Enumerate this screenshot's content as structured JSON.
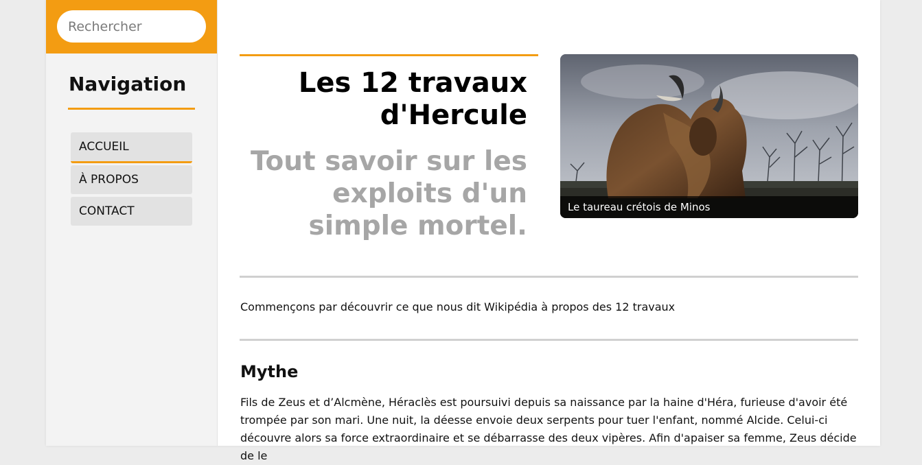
{
  "search": {
    "placeholder": "Rechercher"
  },
  "navigation": {
    "title": "Navigation",
    "items": [
      {
        "label": "ACCUEIL",
        "active": true
      },
      {
        "label": "À PROPOS",
        "active": false
      },
      {
        "label": "CONTACT",
        "active": false
      }
    ]
  },
  "hero": {
    "title": "Les 12 travaux d'Hercule",
    "subtitle": "Tout savoir sur les exploits d'un simple mortel.",
    "image_caption": "Le taureau crétois de Minos"
  },
  "main": {
    "intro": "Commençons par découvrir ce que nous dit Wikipédia à propos des 12 travaux",
    "section_title": "Mythe",
    "paragraph": "Fils de Zeus et d’Alcmène, Héraclès est poursuivi depuis sa naissance par la haine d'Héra, furieuse d'avoir été trompée par son mari. Une nuit, la déesse envoie deux serpents pour tuer l'enfant, nommé Alcide. Celui-ci découvre alors sa force extraordinaire et se débarrasse des deux vipères. Afin d'apaiser sa femme, Zeus décide de le"
  },
  "colors": {
    "accent": "#f39c12",
    "subtitle": "#a6a6a6",
    "sidebar_bg": "#f3f3f3",
    "nav_item_bg": "#e2e2e2"
  }
}
